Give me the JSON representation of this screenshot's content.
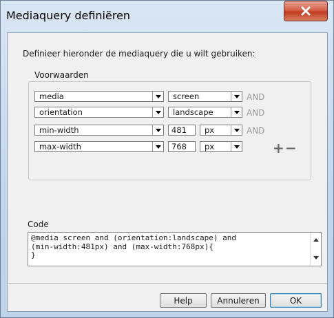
{
  "window": {
    "title": "Mediaquery definiëren",
    "close_icon": "close-icon"
  },
  "description": "Definieer hieronder de mediaquery die u wilt gebruiken:",
  "conditions": {
    "group_label": "Voorwaarden",
    "rows": [
      {
        "property": "media",
        "value": "screen",
        "connector": "AND"
      },
      {
        "property": "orientation",
        "value": "landscape",
        "connector": "AND"
      },
      {
        "property": "min-width",
        "number": "481",
        "unit": "px",
        "connector": "AND"
      },
      {
        "property": "max-width",
        "number": "768",
        "unit": "px"
      }
    ],
    "add_label": "+",
    "remove_label": "−"
  },
  "code": {
    "label": "Code",
    "lines": [
      "@media screen and (orientation:landscape) and",
      "(min-width:481px) and (max-width:768px){",
      "}"
    ]
  },
  "buttons": {
    "help": "Help",
    "cancel": "Annuleren",
    "ok": "OK"
  }
}
